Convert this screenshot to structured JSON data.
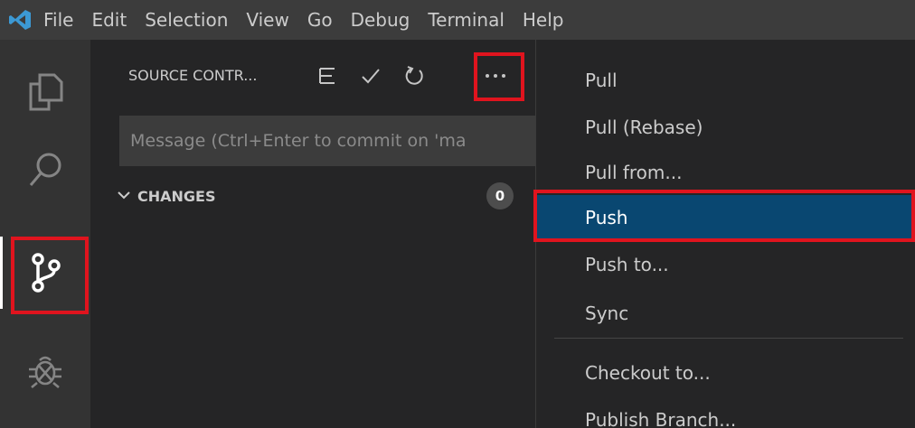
{
  "menubar": {
    "items": [
      "File",
      "Edit",
      "Selection",
      "View",
      "Go",
      "Debug",
      "Terminal",
      "Help"
    ]
  },
  "activity": {
    "icons": [
      "explorer-icon",
      "search-icon",
      "source-control-icon",
      "debug-icon"
    ]
  },
  "sidebar": {
    "title": "SOURCE CONTR...",
    "actions": [
      {
        "name": "view-as-tree-icon",
        "glyph": "☰"
      },
      {
        "name": "commit-check-icon",
        "glyph": "✓"
      },
      {
        "name": "refresh-icon",
        "glyph": "↻"
      },
      {
        "name": "more-actions-icon",
        "glyph": "···"
      }
    ],
    "message_placeholder": "Message (Ctrl+Enter to commit on 'ma",
    "changes_label": "CHANGES",
    "changes_count": "0"
  },
  "context_menu": {
    "items": [
      "Pull",
      "Pull (Rebase)",
      "Pull from...",
      "Push",
      "Push to...",
      "Sync",
      "Checkout to...",
      "Publish Branch..."
    ],
    "selected": "Push"
  },
  "colors": {
    "highlight": "#e0141e",
    "selection": "#094771",
    "vscode_blue": "#3c99d4"
  }
}
